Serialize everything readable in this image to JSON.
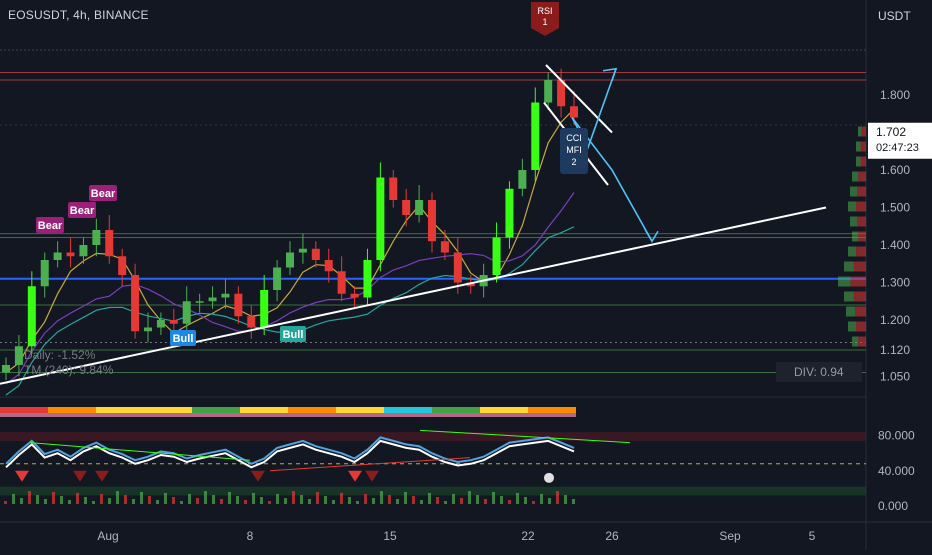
{
  "header": {
    "symbol_line": "EOSUSDT, 4h, BINANCE"
  },
  "stats": {
    "daily": "Daily: -1.52%",
    "tm": "TM (240): 9.84%",
    "div": "DIV: 0.94"
  },
  "colors": {
    "bg": "#131722",
    "up": "#4caf50",
    "up_bright": "#39ff14",
    "down": "#e53935",
    "down_dim": "#c62828",
    "blue_line": "#2962ff",
    "white_line": "#ffffff",
    "cyan_arrow": "#4fc3f7",
    "bear_badge": "#9c1f7a",
    "bull_badge_blue": "#1e88e5",
    "bull_badge_green": "#26a69a",
    "rsi_badge": "#8b1c1c",
    "yellow_ma": "#c6a93b",
    "purple_ma": "#7b3fbf",
    "teal_ma": "#26a69a"
  },
  "chart_data": [
    {
      "type": "line",
      "title": "EOSUSDT, 4h, BINANCE",
      "ylabel": "USDT",
      "ylim": [
        1.0,
        2.0
      ],
      "y_ticks": [
        "1.050",
        "1.120",
        "1.200",
        "1.300",
        "1.400",
        "1.500",
        "1.600",
        "1.800"
      ],
      "x_ticks": [
        "Aug",
        "8",
        "15",
        "22",
        "26",
        "Sep",
        "5"
      ],
      "current_price": "1.702",
      "countdown": "02:47:23",
      "series": [
        {
          "values": [
            1.08,
            1.13,
            1.29,
            1.36,
            1.38,
            1.37,
            1.4,
            1.44,
            1.37,
            1.32,
            1.17,
            1.18,
            1.2,
            1.19,
            1.25,
            1.25,
            1.26,
            1.27,
            1.21,
            1.18,
            1.28,
            1.34,
            1.38,
            1.39,
            1.36,
            1.33,
            1.27,
            1.26,
            1.36,
            1.58,
            1.52,
            1.48,
            1.52,
            1.41,
            1.38,
            1.3,
            1.29,
            1.32,
            1.42,
            1.55,
            1.6,
            1.78,
            1.84,
            1.77,
            1.74
          ]
        }
      ],
      "labels": {
        "bear": "Bear",
        "bull": "Bull",
        "rsi": "RSI",
        "rsi_count": "1",
        "cci": "CCI",
        "mfi": "MFI",
        "cci_count": "2"
      }
    },
    {
      "type": "line",
      "ylim": [
        0,
        100
      ],
      "y_ticks": [
        "0.000",
        "40.000",
        "80.000"
      ],
      "series": [
        {
          "values": [
            44,
            58,
            70,
            55,
            60,
            52,
            62,
            68,
            60,
            55,
            48,
            52,
            58,
            56,
            50,
            54,
            57,
            60,
            52,
            44,
            50,
            62,
            66,
            70,
            64,
            60,
            56,
            50,
            60,
            74,
            70,
            66,
            64,
            56,
            50,
            46,
            48,
            52,
            60,
            68,
            70,
            72,
            74,
            68,
            62
          ]
        }
      ]
    }
  ]
}
